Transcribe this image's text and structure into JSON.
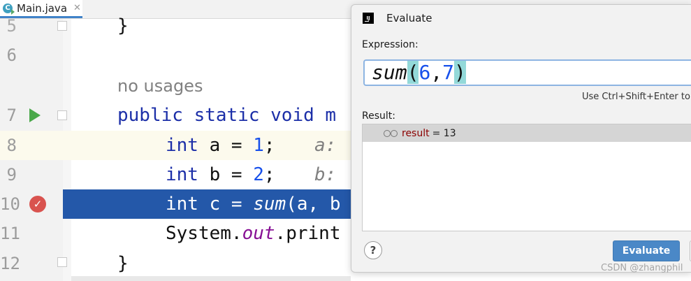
{
  "tab": {
    "icon_letter": "C",
    "label": "Main.java",
    "close": "✕"
  },
  "editor": {
    "lines": [
      {
        "num": "5",
        "code": "}"
      },
      {
        "num": "6",
        "code": ""
      },
      {
        "num": "",
        "code": "no usages"
      },
      {
        "num": "7",
        "kw": "public static void ",
        "rest": "m"
      },
      {
        "num": "8",
        "kw": "int",
        "rest": " a = ",
        "val": "1",
        "tail": ";",
        "hint": "a: "
      },
      {
        "num": "9",
        "kw": "int",
        "rest": " b = ",
        "val": "2",
        "tail": ";",
        "hint": "b: "
      },
      {
        "num": "10",
        "kw": "int",
        "rest": " c = ",
        "call": "sum",
        "tail": "(a, b"
      },
      {
        "num": "11",
        "pre": "System.",
        "static": "out",
        "tail": ".print"
      },
      {
        "num": "12",
        "code": "}"
      }
    ]
  },
  "dialog": {
    "title": "Evaluate",
    "icon_text": "IJ",
    "expression_label": "Expression:",
    "expression": {
      "fn": "sum",
      "open": "(",
      "arg1": "6",
      "comma": ",",
      "arg2": "7",
      "close": ")"
    },
    "hint": "Use Ctrl+Shift+Enter to a",
    "result_label": "Result:",
    "result_name": "result",
    "result_value": "= 13",
    "help_label": "?",
    "evaluate_label": "Evaluate"
  },
  "watermark": "CSDN @zhangphil",
  "colors": {
    "selection": "#2458a9",
    "keyword": "#1c2fa8",
    "number": "#1750eb",
    "button": "#4a88c7"
  }
}
